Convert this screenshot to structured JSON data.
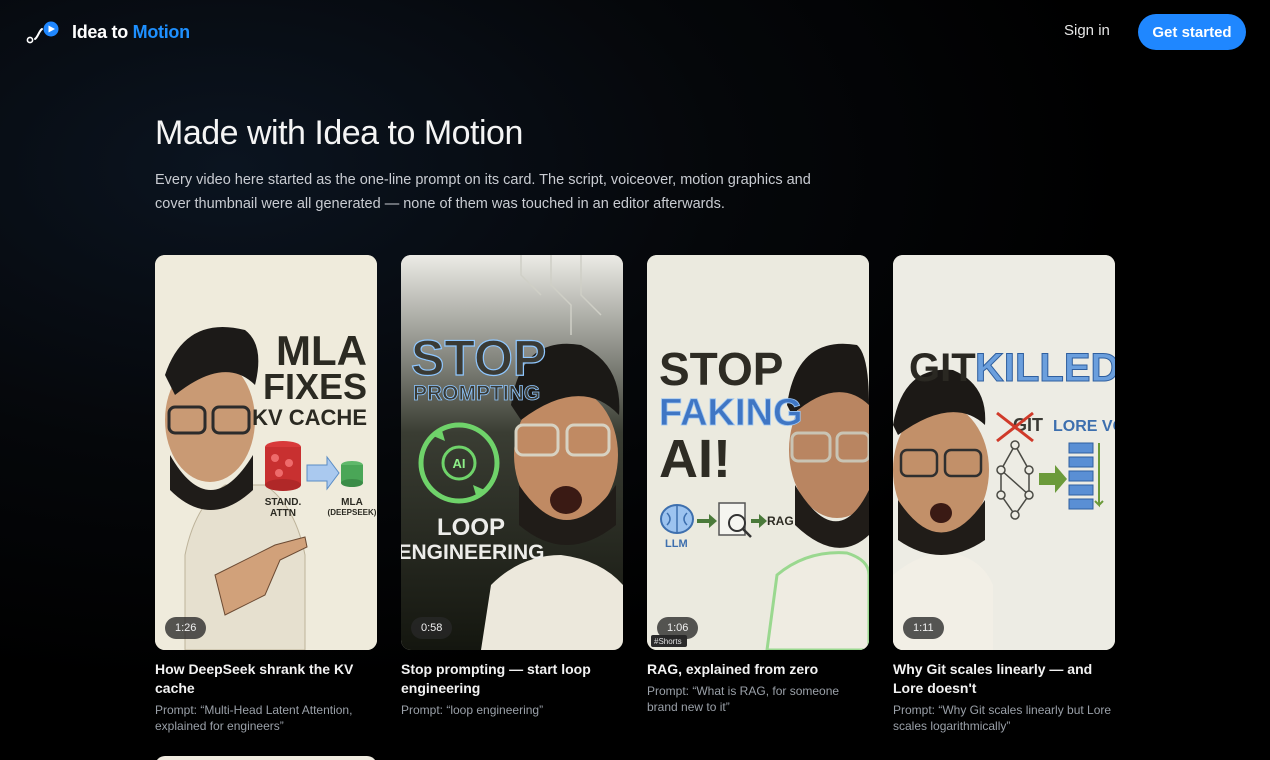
{
  "header": {
    "brand_part1": "Idea to",
    "brand_part2": "Motion",
    "signin_label": "Sign in",
    "cta_label": "Get started"
  },
  "hero": {
    "title": "Made with Idea to Motion",
    "description": "Every video here started as the one-line prompt on its card. The script, voiceover, motion graphics and cover thumbnail were all generated — none of them was touched in an editor afterwards."
  },
  "colors": {
    "accent": "#1f87ff",
    "background": "#05070a"
  },
  "cards": [
    {
      "duration": "1:26",
      "title": "How DeepSeek shrank the KV cache",
      "prompt": "Prompt: “Multi-Head Latent Attention, explained for engineers”",
      "thumb": {
        "line1": "MLA",
        "line2": "FIXES",
        "line3": "KV CACHE",
        "left_label_1": "STAND.",
        "left_label_2": "ATTN",
        "right_label_1": "MLA",
        "right_label_2": "(DEEPSEEK)"
      }
    },
    {
      "duration": "0:58",
      "title": "Stop prompting — start loop engineering",
      "prompt": "Prompt: “loop engineering”",
      "thumb": {
        "line1": "STOP",
        "line2": "PROMPTING",
        "line3": "LOOP",
        "line4": "ENGINEERING",
        "badge": "AI"
      }
    },
    {
      "duration": "1:06",
      "title": "RAG, explained from zero",
      "prompt": "Prompt: “What is RAG, for someone brand new to it”",
      "thumb": {
        "line1": "STOP",
        "line2": "FAKING",
        "line3": "AI!",
        "label_llm": "LLM",
        "label_rag": "RAG",
        "tag": "#Shorts"
      }
    },
    {
      "duration": "1:11",
      "title": "Why Git scales linearly — and Lore doesn't",
      "prompt": "Prompt: “Why Git scales linearly but Lore scales logarithmically”",
      "thumb": {
        "line1": "GIT",
        "line2": "KILLED.",
        "label_git": "GIT",
        "label_lore": "LORE VCS"
      }
    }
  ]
}
